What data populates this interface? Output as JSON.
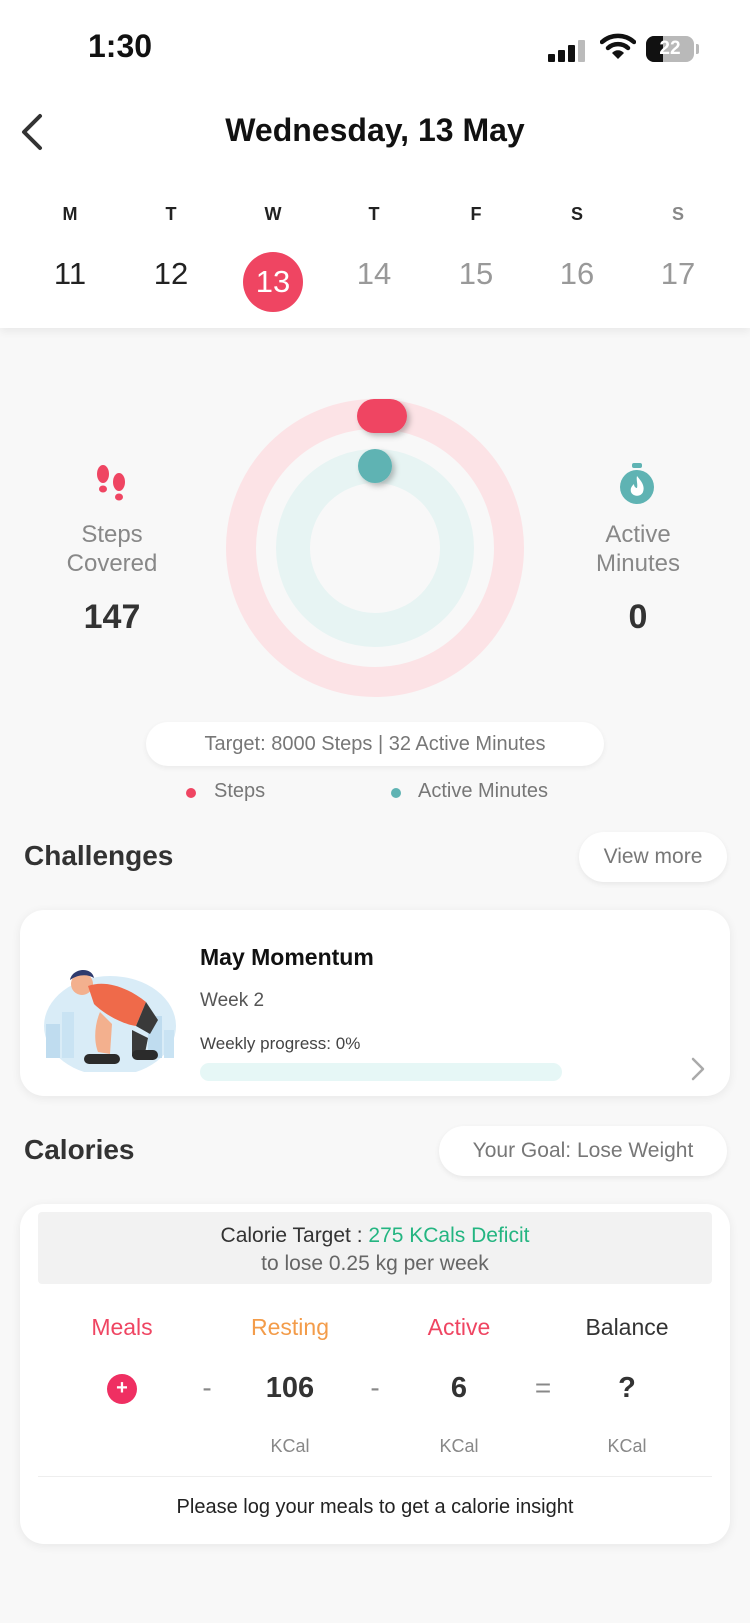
{
  "status_bar": {
    "time": "1:30",
    "battery": "22"
  },
  "header": {
    "title": "Wednesday, 13 May"
  },
  "week": [
    {
      "weekday": "M",
      "date": "11"
    },
    {
      "weekday": "T",
      "date": "12"
    },
    {
      "weekday": "W",
      "date": "13"
    },
    {
      "weekday": "T",
      "date": "14"
    },
    {
      "weekday": "F",
      "date": "15"
    },
    {
      "weekday": "S",
      "date": "16"
    },
    {
      "weekday": "S",
      "date": "17"
    }
  ],
  "activity": {
    "steps": {
      "label_line1": "Steps",
      "label_line2": "Covered",
      "value": "147",
      "icon": "footprints-icon"
    },
    "active": {
      "label_line1": "Active",
      "label_line2": "Minutes",
      "value": "0",
      "icon": "stopwatch-flame-icon"
    },
    "target": "Target: 8000 Steps | 32 Active Minutes",
    "legend": {
      "steps": "Steps",
      "active": "Active Minutes"
    },
    "colors": {
      "steps": "#ef4562",
      "steps_track": "#fce3e6",
      "active": "#5fb3b3",
      "active_track": "#e7f4f3"
    }
  },
  "challenges": {
    "title": "Challenges",
    "view_more": "View more",
    "card": {
      "title": "May Momentum",
      "week": "Week 2",
      "progress_label": "Weekly progress: 0%",
      "progress": 0
    }
  },
  "calories": {
    "title": "Calories",
    "goal": "Your Goal: Lose Weight",
    "target_prefix": "Calorie Target : ",
    "target_value": "275 KCals Deficit",
    "target_sub": "to lose 0.25 kg per week",
    "columns": {
      "meals": {
        "label": "Meals",
        "unit": ""
      },
      "resting": {
        "label": "Resting",
        "value": "106",
        "unit": "KCal"
      },
      "active": {
        "label": "Active",
        "value": "6",
        "unit": "KCal"
      },
      "balance": {
        "label": "Balance",
        "value": "?",
        "unit": "KCal"
      }
    },
    "ops": {
      "minus": "-",
      "equals": "=",
      "plus": "+"
    },
    "insight": "Please log your meals to get a calorie insight"
  }
}
